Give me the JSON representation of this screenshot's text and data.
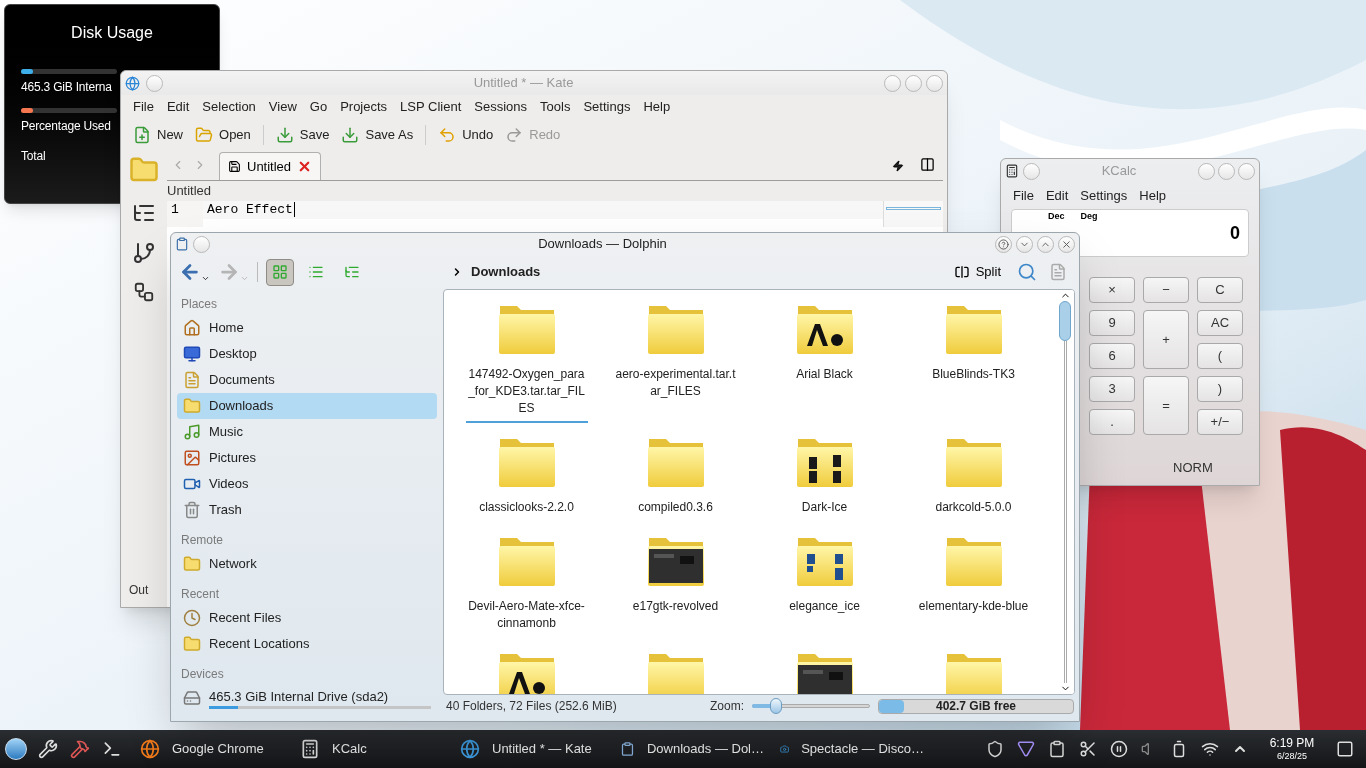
{
  "disk_widget": {
    "title": "Disk Usage",
    "rows": [
      {
        "label": "465.3 GiB Interna",
        "level": 0.12,
        "color": "#3daee9"
      },
      {
        "label": "Percentage Used",
        "level": 0.12,
        "color": "#f47750"
      },
      {
        "label": "Total"
      }
    ]
  },
  "kate": {
    "title": "Untitled * — Kate",
    "menu": [
      "File",
      "Edit",
      "Selection",
      "View",
      "Go",
      "Projects",
      "LSP Client",
      "Sessions",
      "Tools",
      "Settings",
      "Help"
    ],
    "toolbar": [
      {
        "label": "New",
        "kind": "new",
        "disabled": false
      },
      {
        "label": "Open",
        "kind": "open",
        "disabled": false
      },
      {
        "label": "Save",
        "kind": "save",
        "disabled": false
      },
      {
        "label": "Save As",
        "kind": "save-as",
        "disabled": false
      },
      {
        "label": "Undo",
        "kind": "undo",
        "disabled": false
      },
      {
        "label": "Redo",
        "kind": "redo",
        "disabled": true
      }
    ],
    "tabs": [
      {
        "label": "Untitled",
        "selected": true
      }
    ],
    "document_title": "Untitled",
    "lines": [
      {
        "number": "1",
        "text": "Aero Effect"
      }
    ],
    "bottom_panel": "Out"
  },
  "dolphin": {
    "title": "Downloads — Dolphin",
    "view_modes": [
      {
        "kind": "icons",
        "selected": true
      },
      {
        "kind": "compact",
        "selected": false
      },
      {
        "kind": "details",
        "selected": false
      }
    ],
    "breadcrumb": "Downloads",
    "split": "Split",
    "places": [
      {
        "heading": "Places",
        "items": [
          {
            "label": "Home",
            "kind": "home",
            "selected": false
          },
          {
            "label": "Desktop",
            "kind": "desktop",
            "selected": false
          },
          {
            "label": "Documents",
            "kind": "documents",
            "selected": false
          },
          {
            "label": "Downloads",
            "kind": "folder",
            "selected": true
          },
          {
            "label": "Music",
            "kind": "music",
            "selected": false
          },
          {
            "label": "Pictures",
            "kind": "pictures",
            "selected": false
          },
          {
            "label": "Videos",
            "kind": "videos",
            "selected": false
          },
          {
            "label": "Trash",
            "kind": "trash",
            "selected": false
          }
        ]
      },
      {
        "heading": "Remote",
        "items": [
          {
            "label": "Network",
            "kind": "folder",
            "selected": false
          }
        ]
      },
      {
        "heading": "Recent",
        "items": [
          {
            "label": "Recent Files",
            "kind": "clock",
            "selected": false
          },
          {
            "label": "Recent Locations",
            "kind": "folder",
            "selected": false
          }
        ]
      },
      {
        "heading": "Devices",
        "items": [
          {
            "label": "465.3 GiB Internal Drive (sda2)",
            "kind": "drive",
            "selected": false,
            "level": 0.13
          }
        ]
      }
    ],
    "files": [
      {
        "name": "147492-Oxygen_para_for_KDE3.tar.tar_FILES",
        "kind": "plain",
        "current": true
      },
      {
        "name": "aero-experimental.tar.tar_FILES",
        "kind": "plain",
        "current": false
      },
      {
        "name": "Arial Black",
        "kind": "fonts",
        "current": false
      },
      {
        "name": "BlueBlinds-TK3",
        "kind": "plain",
        "current": false
      },
      {
        "name": "classiclooks-2.2.0",
        "kind": "plain",
        "current": false
      },
      {
        "name": "compiled0.3.6",
        "kind": "plain",
        "current": false
      },
      {
        "name": "Dark-Ice",
        "kind": "photos",
        "current": false
      },
      {
        "name": "darkcold-5.0.0",
        "kind": "plain",
        "current": false
      },
      {
        "name": "Devil-Aero-Mate-xfce-cinnamonb",
        "kind": "plain",
        "current": false
      },
      {
        "name": "e17gtk-revolved",
        "kind": "screenshot",
        "current": false
      },
      {
        "name": "elegance_ice",
        "kind": "bluephotos",
        "current": false
      },
      {
        "name": "elementary-kde-blue",
        "kind": "plain",
        "current": false
      },
      {
        "kind": "fonts"
      },
      {
        "kind": "plain"
      },
      {
        "kind": "screenshot"
      },
      {
        "kind": "plain"
      }
    ],
    "status": "40 Folders, 72 Files (252.6 MiB)",
    "zoom_label": "Zoom:",
    "zoom": {
      "level": 0.2
    },
    "free_space": {
      "label": "402.7 GiB free",
      "level": 0.13
    }
  },
  "kcalc": {
    "title": "KCalc",
    "menu": [
      "File",
      "Edit",
      "Settings",
      "Help"
    ],
    "modes": [
      "Dec",
      "Deg"
    ],
    "display": "0",
    "keys": [
      {
        "label": "×",
        "tall": false
      },
      {
        "label": "−",
        "tall": false
      },
      {
        "label": "C",
        "tall": false
      },
      {
        "label": "9",
        "tall": false
      },
      {
        "label": "+",
        "tall": true
      },
      {
        "label": "AC",
        "tall": false
      },
      {
        "label": "6",
        "tall": false
      },
      {
        "label": "(",
        "tall": false
      },
      {
        "label": "3",
        "tall": false
      },
      {
        "label": "=",
        "tall": true
      },
      {
        "label": ")",
        "tall": false
      },
      {
        "label": ".",
        "tall": false
      },
      {
        "label": "+/−",
        "tall": false
      }
    ],
    "status": "NORM"
  },
  "taskbar": {
    "tasks": [
      {
        "label": "Google Chrome",
        "kind": "browser"
      },
      {
        "label": "KCalc",
        "kind": "calculator"
      },
      {
        "label": "Untitled * — Kate",
        "kind": "editor"
      },
      {
        "label": "Downloads — Dol…",
        "kind": "files"
      },
      {
        "label": "Spectacle — Disco…",
        "kind": "screenshot"
      }
    ],
    "time": "6:19 PM",
    "date": "6/28/25"
  }
}
